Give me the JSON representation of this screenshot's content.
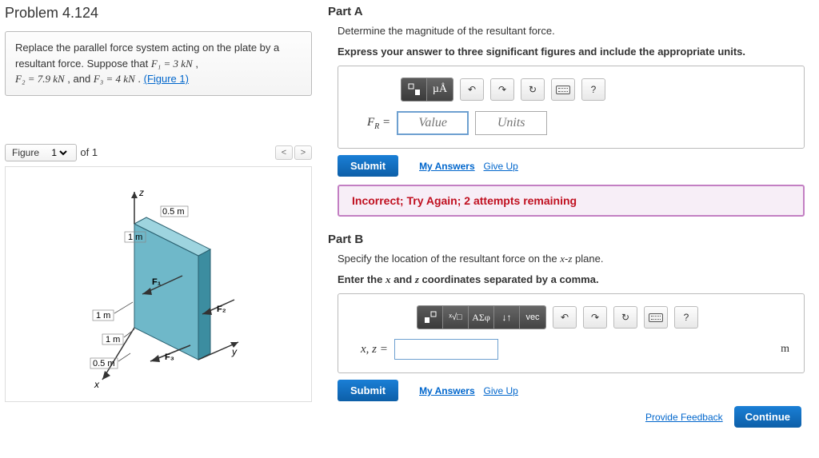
{
  "problem": {
    "title": "Problem 4.124",
    "statement_pre": "Replace the parallel force system acting on the plate by a resultant force. Suppose that ",
    "F1": "F₁ = 3 kN",
    "sep1": " , ",
    "F2": "F₂ = 7.9 kN",
    "sep2": " , and ",
    "F3": "F₃ = 4 kN",
    "statement_post": " . ",
    "figure_link": "(Figure 1)"
  },
  "figure": {
    "label": "Figure",
    "selector": "1",
    "of": "of 1",
    "dims": {
      "z_label": "z",
      "y_label": "y",
      "x_label": "x",
      "d1": "0.5 m",
      "d2": "1 m",
      "d3": "1 m",
      "d4": "1 m",
      "d5": "0.5 m",
      "F1": "F₁",
      "F2": "F₂",
      "F3": "F₃"
    }
  },
  "partA": {
    "heading": "Part A",
    "instr1": "Determine the magnitude of the resultant force.",
    "instr2": "Express your answer to three significant figures and include the appropriate units.",
    "toolbar": {
      "frac": "□",
      "muA": "µÅ",
      "undo": "↶",
      "redo": "↷",
      "reset": "↻",
      "kbd": "⌨",
      "help": "?"
    },
    "var_label": "F_R =",
    "value_placeholder": "Value",
    "units_placeholder": "Units",
    "submit": "Submit",
    "my_answers": "My Answers",
    "give_up": "Give Up",
    "feedback": "Incorrect; Try Again; 2 attempts remaining"
  },
  "partB": {
    "heading": "Part B",
    "instr1": "Specify the location of the resultant force on the x-z plane.",
    "instr2_pre": "Enter the ",
    "instr2_x": "x",
    "instr2_mid": " and ",
    "instr2_z": "z",
    "instr2_post": " coordinates separated by a comma.",
    "toolbar": {
      "tmpl": "□",
      "root": "ˣ√□",
      "greek": "ΑΣφ",
      "arrows": "↓↑",
      "vec": "vec",
      "undo": "↶",
      "redo": "↷",
      "reset": "↻",
      "kbd": "⌨",
      "help": "?"
    },
    "var_label": "x, z =",
    "unit": "m",
    "submit": "Submit",
    "my_answers": "My Answers",
    "give_up": "Give Up"
  },
  "footer": {
    "feedback_link": "Provide Feedback",
    "continue": "Continue"
  }
}
